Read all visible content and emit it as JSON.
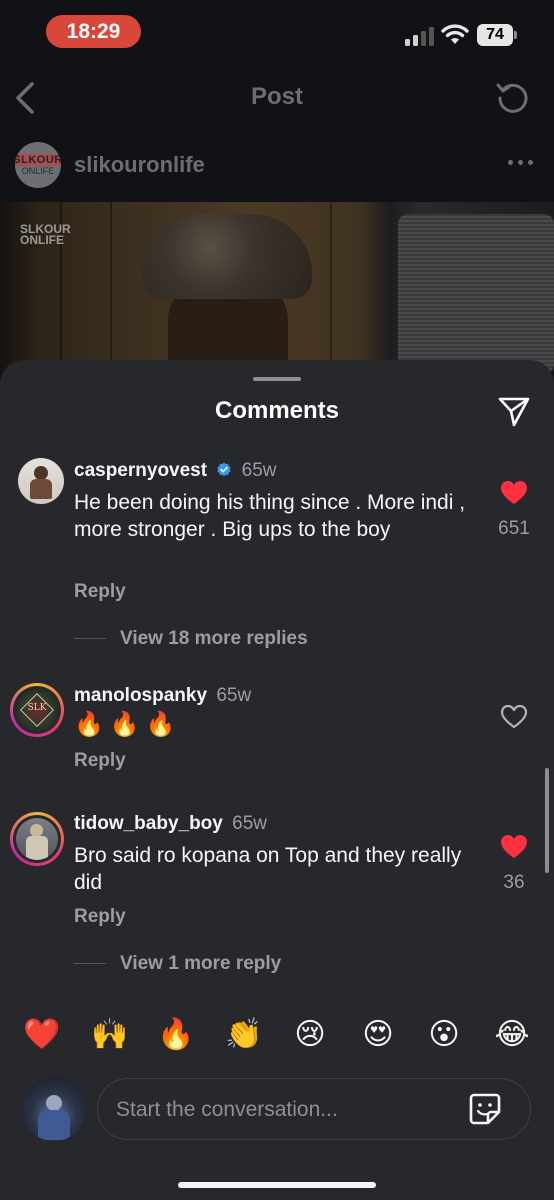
{
  "status_bar": {
    "time": "18:29",
    "battery": "74"
  },
  "nav": {
    "title": "Post"
  },
  "post": {
    "username": "slikouronlife",
    "avatar_line1": "SLKOUR",
    "avatar_line2": "ONLIFE",
    "watermark_line1": "SLKOUR",
    "watermark_line2": "ONLIFE"
  },
  "sheet": {
    "title": "Comments"
  },
  "comments": [
    {
      "username": "caspernyovest",
      "time": "65w",
      "verified": true,
      "text": "He been doing his thing since . More indi , more stronger . Big ups to the boy",
      "reply_label": "Reply",
      "liked": true,
      "like_count": "651",
      "view_more": "View 18 more replies"
    },
    {
      "username": "manolospanky",
      "time": "65w",
      "text": "🔥🔥🔥",
      "reply_label": "Reply",
      "liked": false,
      "avatar_text": "SLK"
    },
    {
      "username": "tidow_baby_boy",
      "time": "65w",
      "text": "Bro said ro kopana on Top and they really did",
      "reply_label": "Reply",
      "liked": true,
      "like_count": "36",
      "view_more": "View 1 more reply"
    }
  ],
  "reactions": [
    "❤️",
    "🙌",
    "🔥",
    "👏",
    "😢",
    "😍",
    "😮",
    "😂"
  ],
  "composer": {
    "placeholder": "Start the conversation..."
  },
  "colors": {
    "like_red": "#ff3040",
    "time_pill": "#d9473b",
    "sheet_bg": "#26282c",
    "verified_blue": "#3897f0"
  }
}
